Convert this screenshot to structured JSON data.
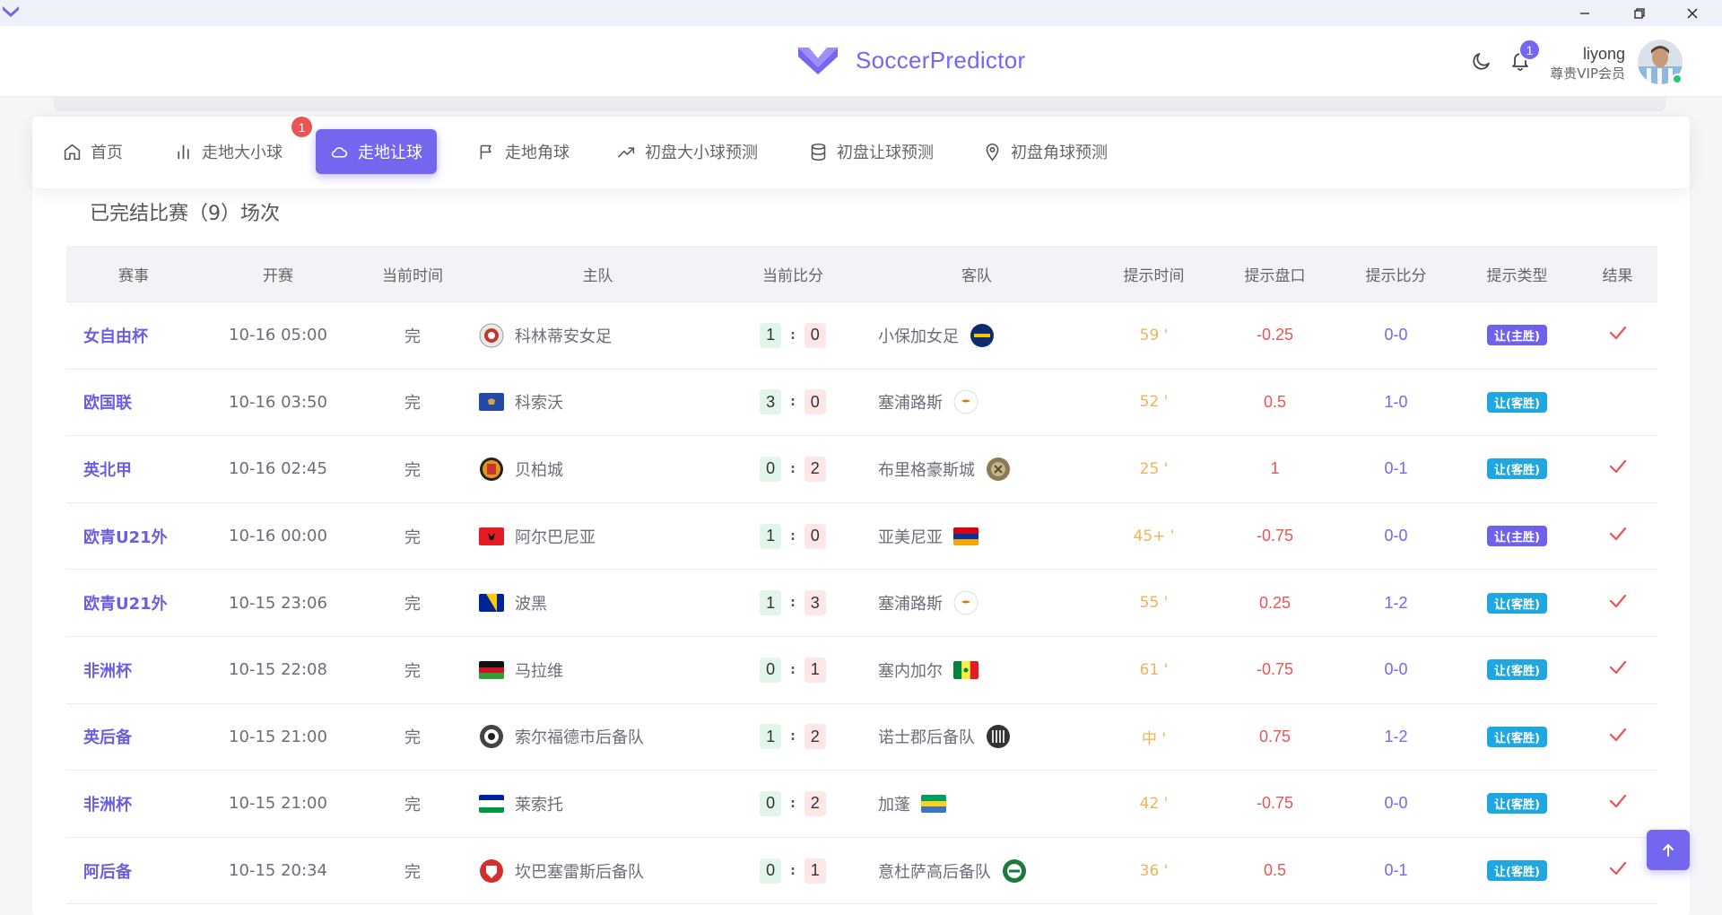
{
  "app": {
    "brand_name": "SoccerPredictor",
    "brand_color": "#7367f0"
  },
  "header": {
    "notification_count": "1",
    "user_name": "liyong",
    "user_role": "尊贵VIP会员"
  },
  "nav": {
    "items": [
      {
        "label": "首页",
        "icon": "home-icon"
      },
      {
        "label": "走地大小球",
        "icon": "bar-chart-icon"
      },
      {
        "label": "走地让球",
        "icon": "cloud-icon",
        "active": true,
        "badge": "1"
      },
      {
        "label": "走地角球",
        "icon": "flag-icon"
      },
      {
        "label": "初盘大小球预测",
        "icon": "trending-up-icon"
      },
      {
        "label": "初盘让球预测",
        "icon": "database-icon"
      },
      {
        "label": "初盘角球预测",
        "icon": "map-pin-icon"
      }
    ]
  },
  "section_title": "已完结比赛（9）场次",
  "table": {
    "headers": [
      "赛事",
      "开赛",
      "当前时间",
      "主队",
      "当前比分",
      "客队",
      "提示时间",
      "提示盘口",
      "提示比分",
      "提示类型",
      "结果"
    ],
    "rows": [
      {
        "league": "女自由杯",
        "start": "10-16 05:00",
        "status": "完",
        "home": "科林蒂安女足",
        "home_score": "1",
        "away_score": "0",
        "away": "小保加女足",
        "tip_time": "59 '",
        "tip_line": "-0.25",
        "tip_score": "0-0",
        "tip_type": "让(主胜)",
        "tip_kind": "home",
        "result": "check"
      },
      {
        "league": "欧国联",
        "start": "10-16 03:50",
        "status": "完",
        "home": "科索沃",
        "home_score": "3",
        "away_score": "0",
        "away": "塞浦路斯",
        "tip_time": "52 '",
        "tip_line": "0.5",
        "tip_score": "1-0",
        "tip_type": "让(客胜)",
        "tip_kind": "away",
        "result": "none"
      },
      {
        "league": "英北甲",
        "start": "10-16 02:45",
        "status": "完",
        "home": "贝柏城",
        "home_score": "0",
        "away_score": "2",
        "away": "布里格豪斯城",
        "tip_time": "25 '",
        "tip_line": "1",
        "tip_score": "0-1",
        "tip_type": "让(客胜)",
        "tip_kind": "away",
        "result": "check"
      },
      {
        "league": "欧青U21外",
        "start": "10-16 00:00",
        "status": "完",
        "home": "阿尔巴尼亚",
        "home_score": "1",
        "away_score": "0",
        "away": "亚美尼亚",
        "tip_time": "45+ '",
        "tip_line": "-0.75",
        "tip_score": "0-0",
        "tip_type": "让(主胜)",
        "tip_kind": "home",
        "result": "check"
      },
      {
        "league": "欧青U21外",
        "start": "10-15 23:06",
        "status": "完",
        "home": "波黑",
        "home_score": "1",
        "away_score": "3",
        "away": "塞浦路斯",
        "tip_time": "55 '",
        "tip_line": "0.25",
        "tip_score": "1-2",
        "tip_type": "让(客胜)",
        "tip_kind": "away",
        "result": "check"
      },
      {
        "league": "非洲杯",
        "start": "10-15 22:08",
        "status": "完",
        "home": "马拉维",
        "home_score": "0",
        "away_score": "1",
        "away": "塞内加尔",
        "tip_time": "61 '",
        "tip_line": "-0.75",
        "tip_score": "0-0",
        "tip_type": "让(客胜)",
        "tip_kind": "away",
        "result": "check"
      },
      {
        "league": "英后备",
        "start": "10-15 21:00",
        "status": "完",
        "home": "索尔福德市后备队",
        "home_score": "1",
        "away_score": "2",
        "away": "诺士郡后备队",
        "tip_time": "中 '",
        "tip_line": "0.75",
        "tip_score": "1-2",
        "tip_type": "让(客胜)",
        "tip_kind": "away",
        "result": "check"
      },
      {
        "league": "非洲杯",
        "start": "10-15 21:00",
        "status": "完",
        "home": "莱索托",
        "home_score": "0",
        "away_score": "2",
        "away": "加蓬",
        "tip_time": "42 '",
        "tip_line": "-0.75",
        "tip_score": "0-0",
        "tip_type": "让(客胜)",
        "tip_kind": "away",
        "result": "check"
      },
      {
        "league": "阿后备",
        "start": "10-15 20:34",
        "status": "完",
        "home": "坎巴塞雷斯后备队",
        "home_score": "0",
        "away_score": "1",
        "away": "意杜萨高后备队",
        "tip_time": "36 '",
        "tip_line": "0.5",
        "tip_score": "0-1",
        "tip_type": "让(客胜)",
        "tip_kind": "away",
        "result": "check"
      }
    ]
  }
}
